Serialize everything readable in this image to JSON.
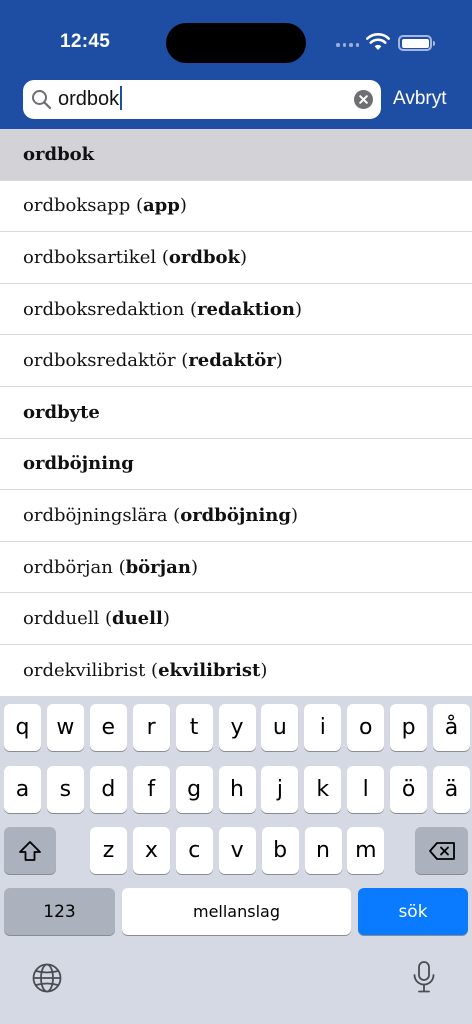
{
  "status": {
    "time": "12:45"
  },
  "search": {
    "query": "ordbok",
    "cancel_label": "Avbryt"
  },
  "results": [
    {
      "word": "ordbok",
      "link": "",
      "bold_word": true,
      "selected": true
    },
    {
      "word": "ordboksapp",
      "link": "app"
    },
    {
      "word": "ordboksartikel",
      "link": "ordbok"
    },
    {
      "word": "ordboksredaktion",
      "link": "redaktion"
    },
    {
      "word": "ordboksredaktör",
      "link": "redaktör"
    },
    {
      "word": "ordbyte",
      "link": "",
      "bold_word": true
    },
    {
      "word": "ordböjning",
      "link": "",
      "bold_word": true
    },
    {
      "word": "ordböjningslära",
      "link": "ordböjning"
    },
    {
      "word": "ordbörjan",
      "link": "början"
    },
    {
      "word": "ordduell",
      "link": "duell"
    },
    {
      "word": "ordekvilibrist",
      "link": "ekvilibrist"
    }
  ],
  "keyboard": {
    "row1": [
      "q",
      "w",
      "e",
      "r",
      "t",
      "y",
      "u",
      "i",
      "o",
      "p",
      "å"
    ],
    "row2": [
      "a",
      "s",
      "d",
      "f",
      "g",
      "h",
      "j",
      "k",
      "l",
      "ö",
      "ä"
    ],
    "row3": [
      "z",
      "x",
      "c",
      "v",
      "b",
      "n",
      "m"
    ],
    "numbers_label": "123",
    "space_label": "mellanslag",
    "return_label": "sök"
  },
  "colors": {
    "header": "#1e4ea3",
    "selected_row": "#d2d2d7",
    "return_key": "#0a7bff"
  }
}
